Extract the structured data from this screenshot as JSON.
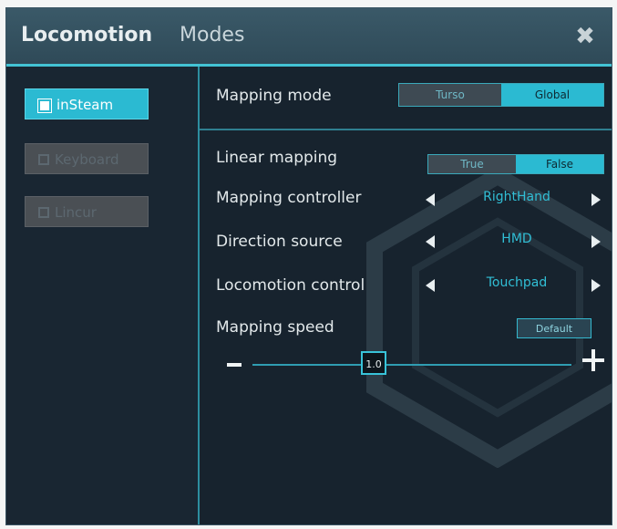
{
  "window": {
    "title_strong": "Locomotion",
    "title_light": "Modes",
    "close_icon": "close-icon"
  },
  "sidebar": {
    "items": [
      {
        "label": "inSteam",
        "active": true
      },
      {
        "label": "Keyboard",
        "active": false
      },
      {
        "label": "Lincur",
        "active": false
      }
    ]
  },
  "main": {
    "mapping_mode": {
      "label": "Mapping mode",
      "options": [
        "Turso",
        "Global"
      ],
      "selected": "Global"
    },
    "linear_mapping": {
      "label": "Linear mapping",
      "options": [
        "True",
        "False"
      ],
      "selected": "False"
    },
    "mapping_controller": {
      "label": "Mapping controller",
      "value": "RightHand"
    },
    "direction_source": {
      "label": "Direction source",
      "value": "HMD"
    },
    "locomotion_control": {
      "label": "Locomotion control",
      "value": "Touchpad"
    },
    "mapping_speed": {
      "label": "Mapping speed",
      "default_label": "Default",
      "value": "1.0",
      "slider_fraction": 0.38
    }
  },
  "colors": {
    "accent": "#2bbad2",
    "background": "#17232e",
    "titlebar": "#34515f"
  }
}
